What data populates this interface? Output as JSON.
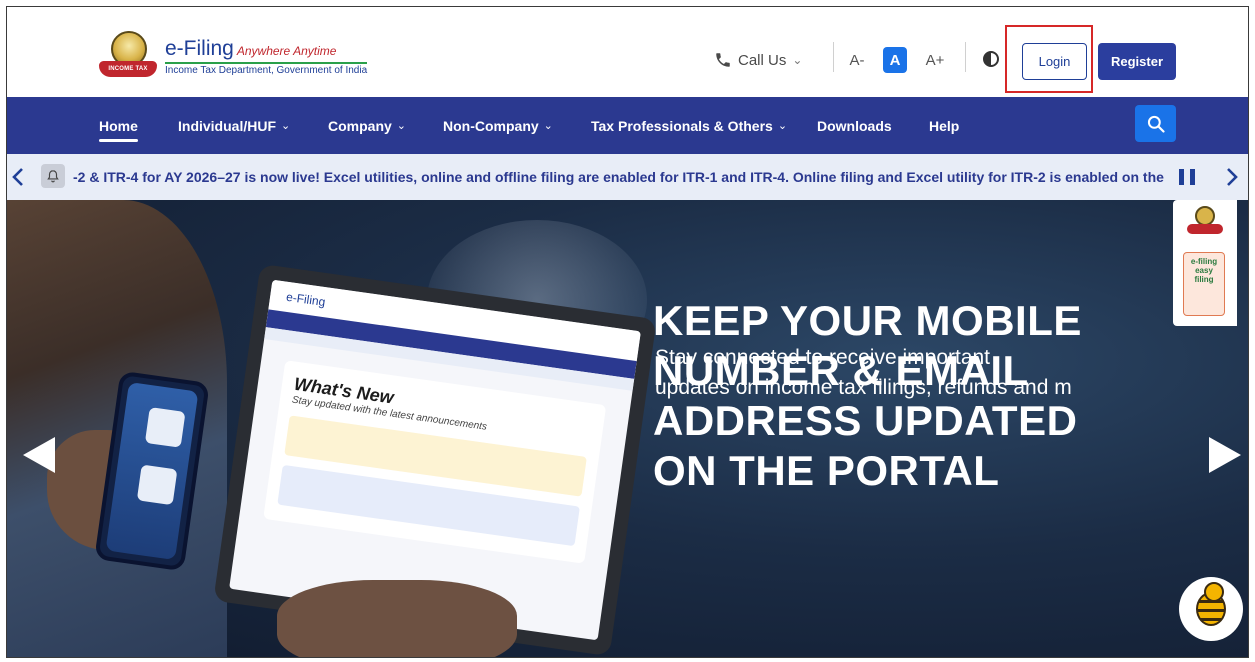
{
  "header": {
    "brand_name": "e-Filing",
    "brand_tagline": "Anywhere Anytime",
    "brand_subtitle": "Income Tax Department, Government of India",
    "emblem_ribbon": "INCOME TAX DEPARTMENT",
    "call_us_label": "Call Us",
    "font_decrease_label": "A-",
    "font_normal_label": "A",
    "font_increase_label": "A+",
    "login_label": "Login",
    "register_label": "Register"
  },
  "nav": {
    "items": [
      {
        "label": "Home",
        "active": true,
        "dropdown": false
      },
      {
        "label": "Individual/HUF",
        "dropdown": true
      },
      {
        "label": "Company",
        "dropdown": true
      },
      {
        "label": "Non-Company",
        "dropdown": true
      },
      {
        "label": "Tax Professionals & Others",
        "dropdown": true
      },
      {
        "label": "Downloads",
        "dropdown": false
      },
      {
        "label": "Help",
        "dropdown": false
      }
    ]
  },
  "ticker": {
    "text": "-2 & ITR-4 for AY 2026–27 is now live! Excel utilities, online and offline filing are enabled for ITR-1 and ITR-4. Online filing and Excel utility for ITR-2 is enabled on the e"
  },
  "hero": {
    "headline_lines": [
      "KEEP YOUR MOBILE",
      "NUMBER & EMAIL",
      "ADDRESS UPDATED",
      "ON THE PORTAL"
    ],
    "subtext_lines": [
      "Stay connected to receive important",
      "updates on income tax filings, refunds and m"
    ],
    "laptop_whats_new": "What's New",
    "laptop_whats_new_sub": "Stay updated with the latest announcements"
  },
  "side_panel": {
    "easy_filing_text": "e-filing easy filing"
  },
  "colors": {
    "nav_bg": "#2b3990",
    "primary_blue": "#1f3f97",
    "search_blue": "#1a73e8",
    "highlight_red": "#d62828",
    "ticker_bg": "#e8edf7"
  },
  "icons": [
    "emblem-logo",
    "phone-icon",
    "chevron-down-icon",
    "contrast-icon",
    "search-icon",
    "bell-icon",
    "chevron-left-icon",
    "chevron-right-icon",
    "pause-icon",
    "slide-prev-icon",
    "slide-next-icon",
    "chatbot-bee-icon"
  ]
}
